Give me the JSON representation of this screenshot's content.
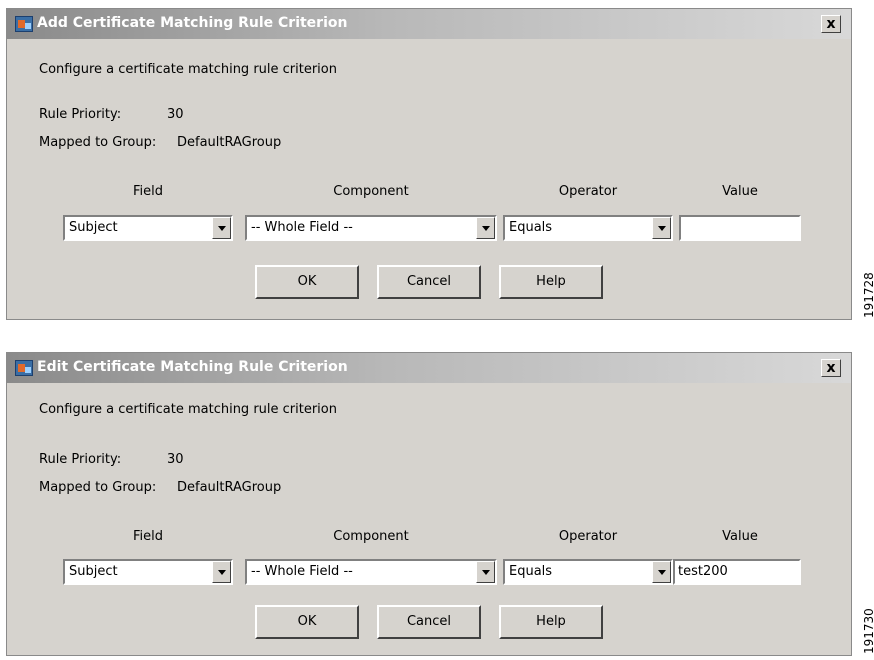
{
  "dialogs": [
    {
      "title": "Add Certificate Matching Rule Criterion",
      "description": "Configure a certificate matching rule criterion",
      "rule_priority_label": "Rule Priority:",
      "rule_priority_value": "30",
      "mapped_group_label": "Mapped to Group:",
      "mapped_group_value": "DefaultRAGroup",
      "field_header": "Field",
      "component_header": "Component",
      "operator_header": "Operator",
      "value_header": "Value",
      "field_value": "Subject",
      "component_value": "-- Whole Field --",
      "operator_value": "Equals",
      "value_input": "",
      "ok_label": "OK",
      "cancel_label": "Cancel",
      "help_label": "Help",
      "close_label": "x"
    },
    {
      "title": "Edit Certificate Matching Rule Criterion",
      "description": "Configure a certificate matching rule criterion",
      "rule_priority_label": "Rule Priority:",
      "rule_priority_value": "30",
      "mapped_group_label": "Mapped to Group:",
      "mapped_group_value": "DefaultRAGroup",
      "field_header": "Field",
      "component_header": "Component",
      "operator_header": "Operator",
      "value_header": "Value",
      "field_value": "Subject",
      "component_value": "-- Whole Field --",
      "operator_value": "Equals",
      "value_input": "test200",
      "ok_label": "OK",
      "cancel_label": "Cancel",
      "help_label": "Help",
      "close_label": "x"
    }
  ],
  "figure_ids": [
    "191728",
    "191730"
  ],
  "colors": {
    "dialog_bg": "#d6d3ce",
    "title_text": "#ffffff"
  },
  "icons": {
    "app": "asdm-app-icon",
    "close": "close-icon",
    "dropdown": "chevron-down-icon"
  }
}
